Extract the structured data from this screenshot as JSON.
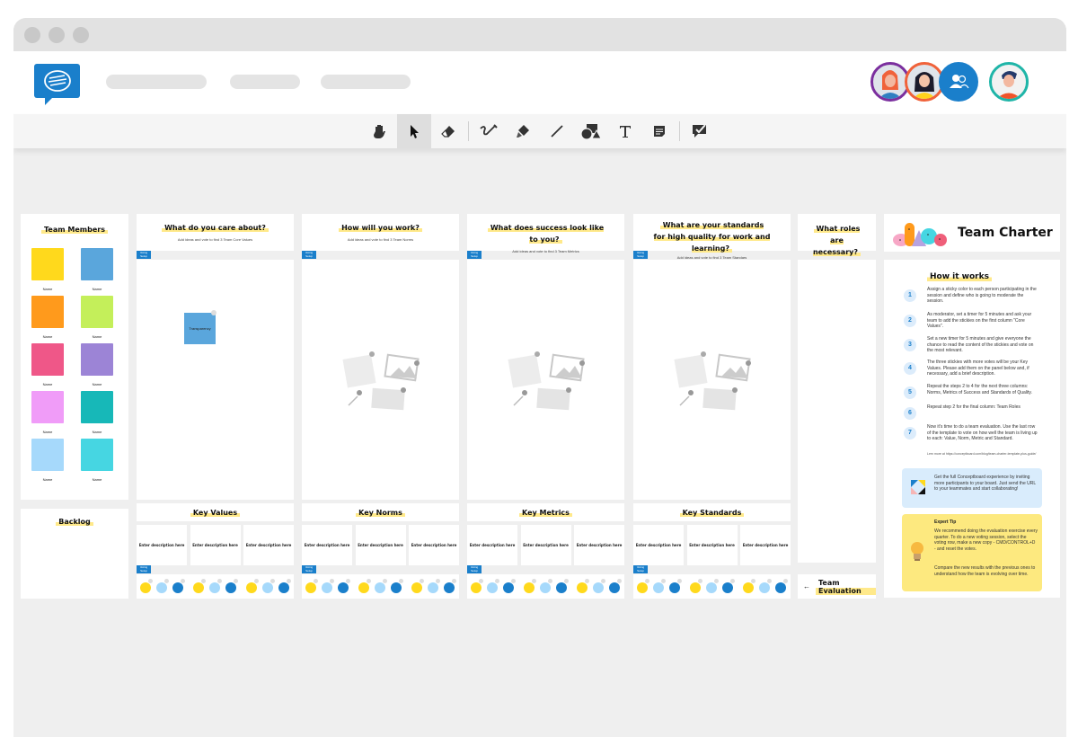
{
  "app": {
    "window_controls": [
      "close",
      "minimize",
      "maximize"
    ],
    "logo": "conceptboard-logo",
    "nav_placeholders": 3
  },
  "toolbar": {
    "tools": [
      {
        "name": "hand-tool",
        "icon": "hand-icon",
        "active": false
      },
      {
        "name": "select-tool",
        "icon": "cursor-icon",
        "active": true
      },
      {
        "name": "eraser-tool",
        "icon": "eraser-icon",
        "active": false
      },
      {
        "name": "pen-tool",
        "icon": "pen-icon",
        "active": false
      },
      {
        "name": "highlighter-tool",
        "icon": "highlighter-icon",
        "active": false
      },
      {
        "name": "line-tool",
        "icon": "line-icon",
        "active": false
      },
      {
        "name": "shapes-tool",
        "icon": "shapes-icon",
        "active": false
      },
      {
        "name": "text-tool",
        "icon": "text-icon",
        "active": false
      },
      {
        "name": "sticky-note-tool",
        "icon": "sticky-note-icon",
        "active": false
      },
      {
        "name": "review-tool",
        "icon": "comment-check-icon",
        "active": false
      }
    ]
  },
  "users": {
    "avatars": [
      {
        "name": "user-1",
        "ring": "#7b2f9e"
      },
      {
        "name": "user-2",
        "ring": "#f0623a"
      },
      {
        "name": "user-group",
        "ring": "#1a7fcb"
      },
      {
        "name": "user-current",
        "ring": "#1fb5a8"
      }
    ]
  },
  "team_members": {
    "title": "Team Members",
    "stickies": [
      {
        "color": "#ffd91c",
        "label": "Name"
      },
      {
        "color": "#5aa6dc",
        "label": "Name"
      },
      {
        "color": "#ff9a1c",
        "label": "Name"
      },
      {
        "color": "#c4ef5a",
        "label": "Name"
      },
      {
        "color": "#ef5788",
        "label": "Name"
      },
      {
        "color": "#9c84d6",
        "label": "Name"
      },
      {
        "color": "#f09cf8",
        "label": "Name"
      },
      {
        "color": "#17b8b8",
        "label": "Name"
      },
      {
        "color": "#a6d9fb",
        "label": "Name"
      },
      {
        "color": "#46d6e2",
        "label": "Name"
      }
    ]
  },
  "backlog": {
    "title": "Backlog"
  },
  "columns": [
    {
      "title": "What do you care about?",
      "subtitle": "Add ideas and vote to find 3 Team Core Values",
      "key_title": "Key Values",
      "tag": "Voting Setup"
    },
    {
      "title": "How will you work?",
      "subtitle": "Add ideas and vote to find 3 Team Norms",
      "key_title": "Key Norms",
      "tag": "Voting Setup"
    },
    {
      "title": "What does success look like to you?",
      "subtitle": "Add ideas and vote to find 3 Team Metrics",
      "key_title": "Key Metrics",
      "tag": "Voting Setup"
    },
    {
      "title": "What are your standards for high quality for work and learning?",
      "subtitle": "Add ideas and vote to find 3 Team Standars",
      "key_title": "Key Standards",
      "tag": "Voting Setup"
    }
  ],
  "roles": {
    "title": "What roles are necessary?"
  },
  "description_placeholder": "Enter description here",
  "sticky_on_board": {
    "text": "Transparency",
    "color": "#5aa6dc"
  },
  "team_evaluation": {
    "label": "Team Evaluation",
    "arrow": "←"
  },
  "voting_colors": {
    "sad": "#ffd91c",
    "neutral": "#a6d9fb",
    "happy": "#1a7fcb"
  },
  "charter": {
    "title": "Team Charter",
    "how_title": "How it works",
    "steps": [
      {
        "num": "1",
        "text": "Assign a sticky color to each person participating in the session and define who is going to moderate the session."
      },
      {
        "num": "2",
        "text": "As moderator, set a timer for 5 minutes and ask your team to add the stickies on the first column \"Core Values\"."
      },
      {
        "num": "3",
        "text": "Set a new timer for 5 minutes and give everyone the chance to read the content of the stickies and vote on the most relevant."
      },
      {
        "num": "4",
        "text": "The three stickies with more votes will be your Key Values. Please add them on the panel below and, if necessary, add a brief description."
      },
      {
        "num": "5",
        "text": "Repeat the steps 2 to 4 for the next three columns: Norms, Metrics of Success and Standards of Quality."
      },
      {
        "num": "6",
        "text": "Repeat step 2 for the final column: Team Roles"
      },
      {
        "num": "7",
        "text": "Now it's time to do a team evaluation. Use the last row of the template to vote on how well the team is living up to each: Value, Norm, Metric and Standard."
      }
    ],
    "learn_more": "Lern more at https://conceptboard.com/blog/team-charter-template-plus-guide/",
    "invite_text": "Get the full Conceptboard experience by inviting more participants to your board. Just send the URL to your teammates and start collaborating!",
    "tip_title": "Expert Tip",
    "tip_text_1": "We recommend doing the evaluation exercise every quarter. To do a new voting session, select the voting row, make a new copy - CMD/CONTROL+D - and reset the votes.",
    "tip_text_2": "Compare the new results with the previous ones to understand how the team is evolving over time."
  }
}
